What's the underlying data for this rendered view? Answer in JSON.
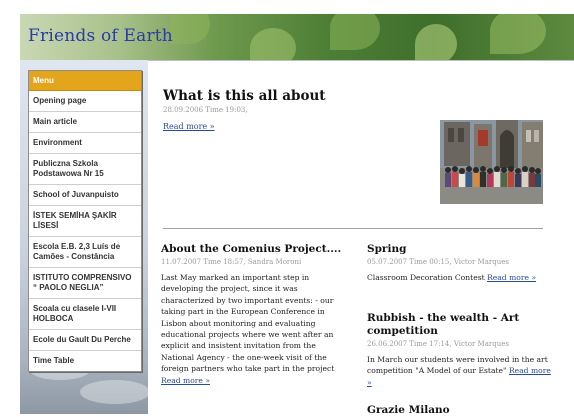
{
  "site_title": "Friends of Earth",
  "menu": {
    "heading": "Menu",
    "items": [
      "Opening page",
      "Main article",
      "Environment",
      "Publiczna Szkola Podstawowa Nr 15",
      "School of Juvanpuisto",
      "İSTEK SEMİHA ŞAKİR LİSESİ",
      "Escola E.B. 2,3 Luís de Camões - Constância",
      "ISTITUTO COMPRENSIVO “ PAOLO NEGLIA”",
      "Scoala cu clasele I-VII HOLBOCA",
      "Ecole du Gault Du Perche",
      "Time Table"
    ]
  },
  "featured": {
    "title": "What is this all about",
    "date": "28.09.2006 Time 19:03,",
    "read_more": "Read more »"
  },
  "posts_left": [
    {
      "title": "About the Comenius Project....",
      "meta": "11.07.2007 Time 18:57, Sandra Moroni",
      "body": "Last May marked an important step in developing the project, since it was characterized by two important events: - our taking part in the European Conference in Lisbon about monitoring and evaluating educational projects where we went after an explicit and insistent invitation from the National Agency - the one-week visit of the foreign partners who take part in the project",
      "read_more": "Read more »"
    }
  ],
  "posts_right": [
    {
      "title": "Spring",
      "meta": "05.07.2007 Time 00:15, Victor Marques",
      "body": "Classroom Decoration Contest",
      "read_more": "Read more »"
    },
    {
      "title": "Rubbish - the wealth - Art competition",
      "meta": "26.06.2007 Time 17:14, Victor Marques",
      "body": "In March our students were involved in the art competition \"A Model of our Estate\"",
      "read_more": "Read more »"
    },
    {
      "title": "Grazie Milano"
    }
  ]
}
